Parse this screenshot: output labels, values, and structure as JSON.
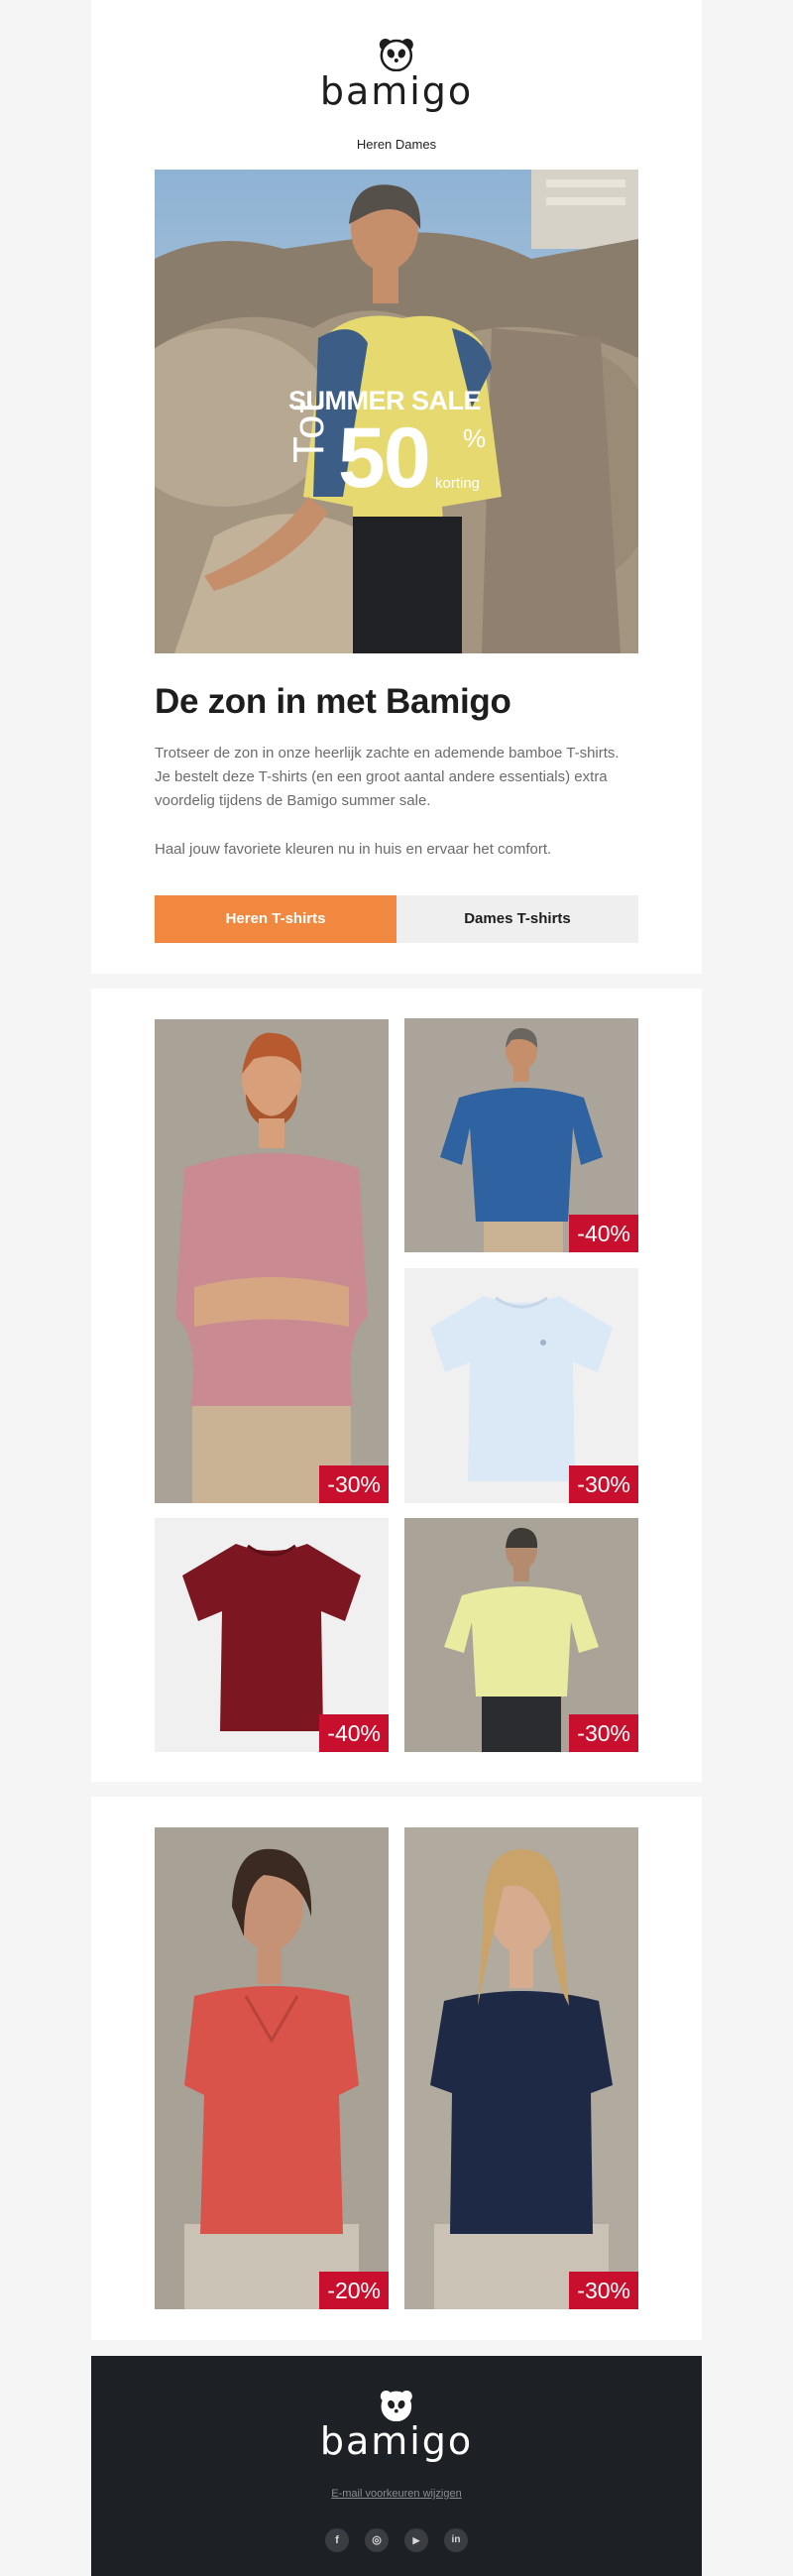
{
  "brand": {
    "name": "bamigo"
  },
  "nav": {
    "men": "Heren",
    "women": "Dames"
  },
  "hero": {
    "headline": "SUMMER SALE",
    "prefix": "Tot",
    "amount": "50",
    "percent": "%",
    "suffix": "korting"
  },
  "intro": {
    "title": "De zon in met Bamigo",
    "paragraph1": "Trotseer de zon in onze heerlijk zachte en ademende bamboe T-shirts. Je bestelt deze T-shirts (en een groot aantal andere essentials) extra voordelig tijdens de Bamigo summer sale.",
    "paragraph2": "Haal jouw favoriete kleuren nu in huis en ervaar het comfort."
  },
  "buttons": {
    "men": "Heren T-shirts",
    "women": "Dames T-shirts"
  },
  "men_products": [
    {
      "discount": "-30%",
      "color": "#c98a92"
    },
    {
      "discount": "-40%",
      "color": "#2f62a0"
    },
    {
      "discount": "-30%",
      "color": "#dbe9f7"
    },
    {
      "discount": "-40%",
      "color": "#7c1722"
    },
    {
      "discount": "-30%",
      "color": "#e9eca0"
    }
  ],
  "women_products": [
    {
      "discount": "-20%",
      "color": "#d9534a"
    },
    {
      "discount": "-30%",
      "color": "#1e2945"
    }
  ],
  "footer": {
    "preferences_link": "E-mail voorkeuren wijzigen",
    "social": [
      {
        "icon": "facebook-icon",
        "glyph": "f"
      },
      {
        "icon": "instagram-icon",
        "glyph": "◎"
      },
      {
        "icon": "youtube-icon",
        "glyph": "▶"
      },
      {
        "icon": "linkedin-icon",
        "glyph": "in"
      }
    ]
  },
  "colors": {
    "accent": "#f0883f",
    "badge": "#c8102e",
    "footer_bg": "#1d2024",
    "page_bg": "#f5f5f5"
  }
}
